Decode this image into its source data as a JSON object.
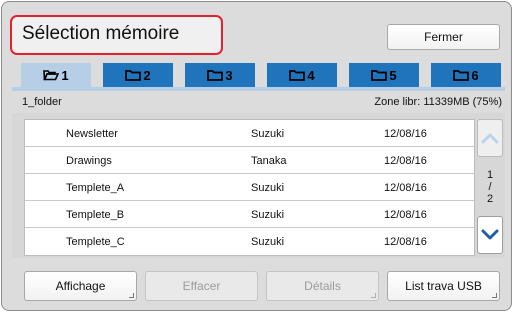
{
  "title": "Sélection mémoire",
  "close_label": "Fermer",
  "tabs": [
    {
      "label": "1",
      "icon": "open-folder-icon",
      "active": true
    },
    {
      "label": "2",
      "icon": "folder-icon",
      "active": false
    },
    {
      "label": "3",
      "icon": "folder-icon",
      "active": false
    },
    {
      "label": "4",
      "icon": "folder-icon",
      "active": false
    },
    {
      "label": "5",
      "icon": "folder-icon",
      "active": false
    },
    {
      "label": "6",
      "icon": "folder-icon",
      "active": false
    }
  ],
  "folder_name": "1_folder",
  "free_space": "Zone libr: 11339MB (75%)",
  "rows": [
    {
      "name": "Newsletter",
      "owner": "Suzuki",
      "date": "12/08/16"
    },
    {
      "name": "Drawings",
      "owner": "Tanaka",
      "date": "12/08/16"
    },
    {
      "name": "Templete_A",
      "owner": "Suzuki",
      "date": "12/08/16"
    },
    {
      "name": "Templete_B",
      "owner": "Suzuki",
      "date": "12/08/16"
    },
    {
      "name": "Templete_C",
      "owner": "Suzuki",
      "date": "12/08/16"
    }
  ],
  "page": {
    "current": "1",
    "sep": "/",
    "total": "2"
  },
  "scroll": {
    "up_icon": "chevron-up-icon",
    "down_icon": "chevron-down-icon"
  },
  "buttons": {
    "display": "Affichage",
    "delete": "Effacer",
    "details": "Détails",
    "usb": "List trava USB"
  },
  "colors": {
    "accent": "#1f74bb",
    "active_tab": "#b6cfe7",
    "highlight": "#e4212f"
  }
}
